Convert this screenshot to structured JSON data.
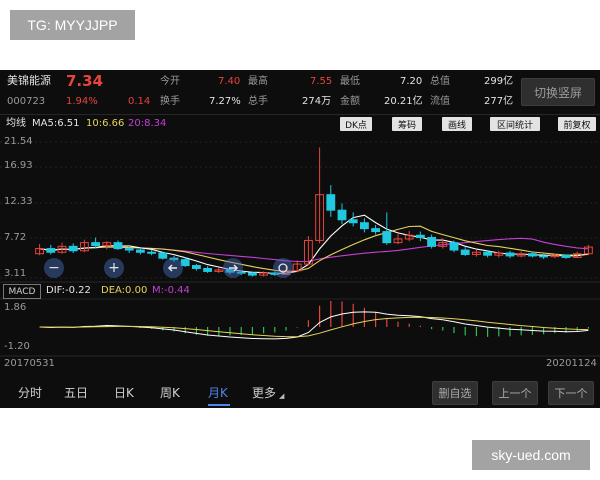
{
  "watermarks": {
    "top_left": "TG: MYYJJPP",
    "bottom_right": "sky-ued.com"
  },
  "header": {
    "stock_name": "美锦能源",
    "price": "7.34",
    "code": "000723",
    "change_pct": "1.94%",
    "change_amt": "0.14",
    "labels": {
      "open": "今开",
      "high": "最高",
      "low": "最低",
      "total_value": "总值",
      "turnover": "换手",
      "volume": "总手",
      "amount": "金额",
      "float_value": "流值"
    },
    "values": {
      "open": "7.40",
      "high": "7.55",
      "low": "7.20",
      "total_value": "299亿",
      "turnover": "7.27%",
      "volume": "274万",
      "amount": "20.21亿",
      "float_value": "277亿"
    },
    "switch_button": "切换竖屏"
  },
  "ma_bar": {
    "label": "均线",
    "ma5": "MA5:6.51",
    "ma10": "10:6.66",
    "ma20": "20:8.34",
    "tools": [
      "DK点",
      "筹码",
      "画线",
      "区间统计",
      "前复权"
    ]
  },
  "price_axis": [
    "21.54",
    "16.93",
    "12.33",
    "7.72",
    "3.11"
  ],
  "macd_bar": {
    "indicator": "MACD",
    "dif": "DIF:-0.22",
    "dea": "DEA:0.00",
    "m": "M:-0.44"
  },
  "macd_axis": [
    "1.86",
    "-1.20"
  ],
  "date_range": {
    "start": "20170531",
    "end": "20201124"
  },
  "colors": {
    "up": "#e8443b",
    "down": "#20c9e0",
    "ma5": "#ffffff",
    "ma10": "#e6d35a",
    "ma20": "#c43fd6",
    "accent": "#4f86e8"
  },
  "chart_data": {
    "type": "candlestick",
    "ylim": [
      3.11,
      21.54
    ],
    "candles": [
      {
        "o": 6.4,
        "c": 7.1,
        "h": 7.7,
        "l": 6.2
      },
      {
        "o": 7.1,
        "c": 6.6,
        "h": 7.6,
        "l": 6.3
      },
      {
        "o": 6.6,
        "c": 7.4,
        "h": 7.9,
        "l": 6.4
      },
      {
        "o": 7.4,
        "c": 6.8,
        "h": 7.8,
        "l": 6.5
      },
      {
        "o": 6.8,
        "c": 7.9,
        "h": 8.3,
        "l": 6.6
      },
      {
        "o": 7.9,
        "c": 7.5,
        "h": 8.6,
        "l": 7.1
      },
      {
        "o": 7.5,
        "c": 7.9,
        "h": 8.1,
        "l": 7.0
      },
      {
        "o": 7.9,
        "c": 7.1,
        "h": 8.2,
        "l": 6.9
      },
      {
        "o": 7.1,
        "c": 6.9,
        "h": 7.3,
        "l": 6.5
      },
      {
        "o": 6.9,
        "c": 6.6,
        "h": 7.2,
        "l": 6.3
      },
      {
        "o": 6.6,
        "c": 6.5,
        "h": 6.9,
        "l": 6.2
      },
      {
        "o": 6.5,
        "c": 5.8,
        "h": 6.7,
        "l": 5.6
      },
      {
        "o": 5.8,
        "c": 5.6,
        "h": 6.1,
        "l": 5.3
      },
      {
        "o": 5.6,
        "c": 4.8,
        "h": 5.9,
        "l": 4.6
      },
      {
        "o": 4.8,
        "c": 4.4,
        "h": 5.0,
        "l": 4.1
      },
      {
        "o": 4.4,
        "c": 4.0,
        "h": 4.7,
        "l": 3.8
      },
      {
        "o": 4.0,
        "c": 4.2,
        "h": 4.5,
        "l": 3.8
      },
      {
        "o": 4.2,
        "c": 3.9,
        "h": 4.5,
        "l": 3.6
      },
      {
        "o": 3.9,
        "c": 3.8,
        "h": 4.1,
        "l": 3.5
      },
      {
        "o": 3.8,
        "c": 3.5,
        "h": 4.0,
        "l": 3.3
      },
      {
        "o": 3.5,
        "c": 3.8,
        "h": 4.0,
        "l": 3.3
      },
      {
        "o": 3.8,
        "c": 3.6,
        "h": 4.0,
        "l": 3.4
      },
      {
        "o": 3.6,
        "c": 4.1,
        "h": 4.6,
        "l": 3.5
      },
      {
        "o": 4.1,
        "c": 5.0,
        "h": 5.5,
        "l": 3.9
      },
      {
        "o": 5.0,
        "c": 8.2,
        "h": 8.8,
        "l": 4.8
      },
      {
        "o": 8.2,
        "c": 14.4,
        "h": 20.8,
        "l": 7.8
      },
      {
        "o": 14.4,
        "c": 12.3,
        "h": 15.7,
        "l": 11.4
      },
      {
        "o": 12.3,
        "c": 11.0,
        "h": 13.2,
        "l": 10.4
      },
      {
        "o": 11.0,
        "c": 10.6,
        "h": 12.0,
        "l": 10.1
      },
      {
        "o": 10.6,
        "c": 9.8,
        "h": 11.2,
        "l": 9.3
      },
      {
        "o": 9.8,
        "c": 9.4,
        "h": 10.3,
        "l": 9.0
      },
      {
        "o": 9.4,
        "c": 7.9,
        "h": 12.0,
        "l": 7.6
      },
      {
        "o": 7.9,
        "c": 8.4,
        "h": 9.2,
        "l": 7.7
      },
      {
        "o": 8.4,
        "c": 8.9,
        "h": 9.5,
        "l": 8.1
      },
      {
        "o": 8.9,
        "c": 8.6,
        "h": 9.4,
        "l": 8.1
      },
      {
        "o": 8.6,
        "c": 7.4,
        "h": 9.0,
        "l": 7.1
      },
      {
        "o": 7.4,
        "c": 7.9,
        "h": 8.5,
        "l": 7.1
      },
      {
        "o": 7.9,
        "c": 6.9,
        "h": 8.2,
        "l": 6.6
      },
      {
        "o": 6.9,
        "c": 6.3,
        "h": 7.3,
        "l": 6.1
      },
      {
        "o": 6.3,
        "c": 6.6,
        "h": 7.0,
        "l": 6.0
      },
      {
        "o": 6.6,
        "c": 6.2,
        "h": 6.9,
        "l": 5.9
      },
      {
        "o": 6.2,
        "c": 6.5,
        "h": 6.8,
        "l": 5.9
      },
      {
        "o": 6.5,
        "c": 6.1,
        "h": 6.8,
        "l": 5.8
      },
      {
        "o": 6.1,
        "c": 6.4,
        "h": 6.7,
        "l": 5.9
      },
      {
        "o": 6.4,
        "c": 6.1,
        "h": 6.6,
        "l": 5.9
      },
      {
        "o": 6.1,
        "c": 6.0,
        "h": 6.4,
        "l": 5.7
      },
      {
        "o": 6.0,
        "c": 6.2,
        "h": 6.4,
        "l": 5.8
      },
      {
        "o": 6.2,
        "c": 5.9,
        "h": 6.3,
        "l": 5.7
      },
      {
        "o": 5.9,
        "c": 6.4,
        "h": 6.7,
        "l": 5.8
      },
      {
        "o": 6.4,
        "c": 7.3,
        "h": 7.6,
        "l": 6.2
      }
    ]
  },
  "tabs": [
    "分时",
    "五日",
    "日K",
    "周K",
    "月K",
    "更多"
  ],
  "active_tab": "月K",
  "actions": {
    "delete_watch": "删自选",
    "prev": "上一个",
    "next": "下一个"
  },
  "controls": {
    "zoom_out": "−",
    "zoom_in": "+"
  }
}
